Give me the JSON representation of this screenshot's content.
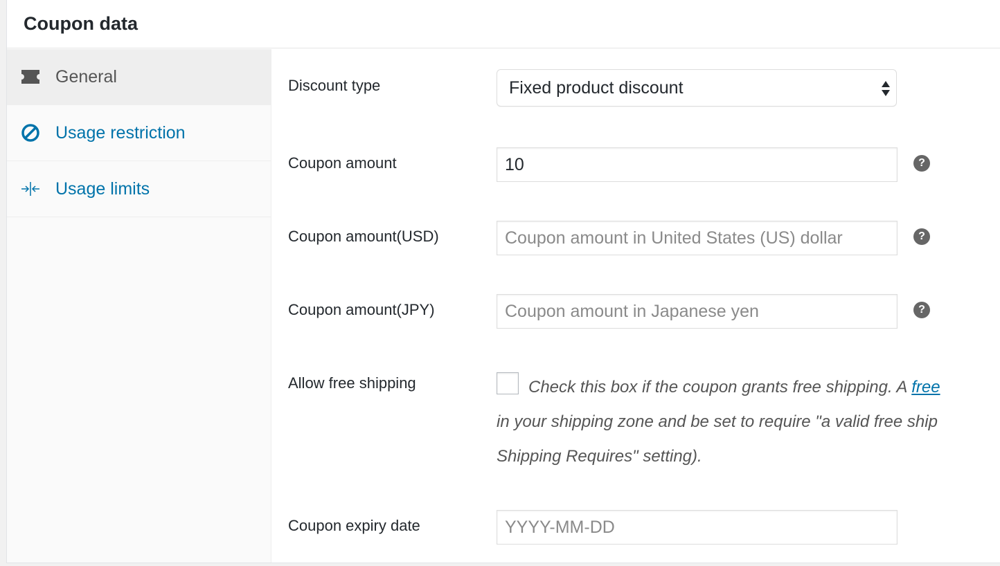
{
  "panel": {
    "title": "Coupon data"
  },
  "tabs": [
    {
      "label": "General",
      "icon": "ticket-icon",
      "active": true
    },
    {
      "label": "Usage restriction",
      "icon": "block-icon",
      "active": false
    },
    {
      "label": "Usage limits",
      "icon": "arrows-in-icon",
      "active": false
    }
  ],
  "fields": {
    "discount_type": {
      "label": "Discount type",
      "value": "Fixed product discount"
    },
    "coupon_amount": {
      "label": "Coupon amount",
      "value": "10"
    },
    "coupon_amount_usd": {
      "label": "Coupon amount(USD)",
      "placeholder": "Coupon amount in United States (US) dollar"
    },
    "coupon_amount_jpy": {
      "label": "Coupon amount(JPY)",
      "placeholder": "Coupon amount in Japanese yen"
    },
    "free_shipping": {
      "label": "Allow free shipping",
      "description_line1": "Check this box if the coupon grants free shipping. A ",
      "link_text": "free",
      "description_line2": "in your shipping zone and be set to require \"a valid free ship",
      "description_line3": "Shipping Requires\" setting)."
    },
    "expiry_date": {
      "label": "Coupon expiry date",
      "placeholder": "YYYY-MM-DD"
    }
  },
  "help_icon_glyph": "?",
  "colors": {
    "link": "#0073aa",
    "active_tab_bg": "#eeeeee",
    "help_icon_bg": "#666666"
  }
}
